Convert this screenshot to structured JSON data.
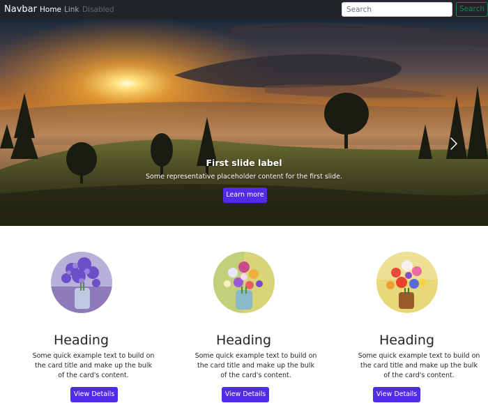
{
  "navbar": {
    "brand": "Navbar",
    "links": [
      {
        "label": "Home",
        "state": "active"
      },
      {
        "label": "Link",
        "state": "normal"
      },
      {
        "label": "Disabled",
        "state": "disabled"
      }
    ],
    "search": {
      "placeholder": "Search",
      "value": "",
      "button_label": "Search"
    }
  },
  "carousel": {
    "slide_title": "First slide label",
    "slide_text": "Some representative placeholder content for the first slide.",
    "button_label": "Learn more",
    "next_icon": "chevron-right-icon"
  },
  "cards": [
    {
      "heading": "Heading",
      "text": "Some quick example text to build on the card title and make up the bulk of the card's content.",
      "button_label": "View Details",
      "image": "lavender-flowers-vase"
    },
    {
      "heading": "Heading",
      "text": "Some quick example text to build on the card title and make up the bulk of the card's content.",
      "button_label": "View Details",
      "image": "mixed-wildflowers-vase"
    },
    {
      "heading": "Heading",
      "text": "Some quick example text to build on the card title and make up the bulk of the card's content.",
      "button_label": "View Details",
      "image": "roses-bouquet-vase"
    }
  ],
  "colors": {
    "navbar_bg": "#212529",
    "primary": "#4f2de8",
    "search_outline": "#198754"
  }
}
